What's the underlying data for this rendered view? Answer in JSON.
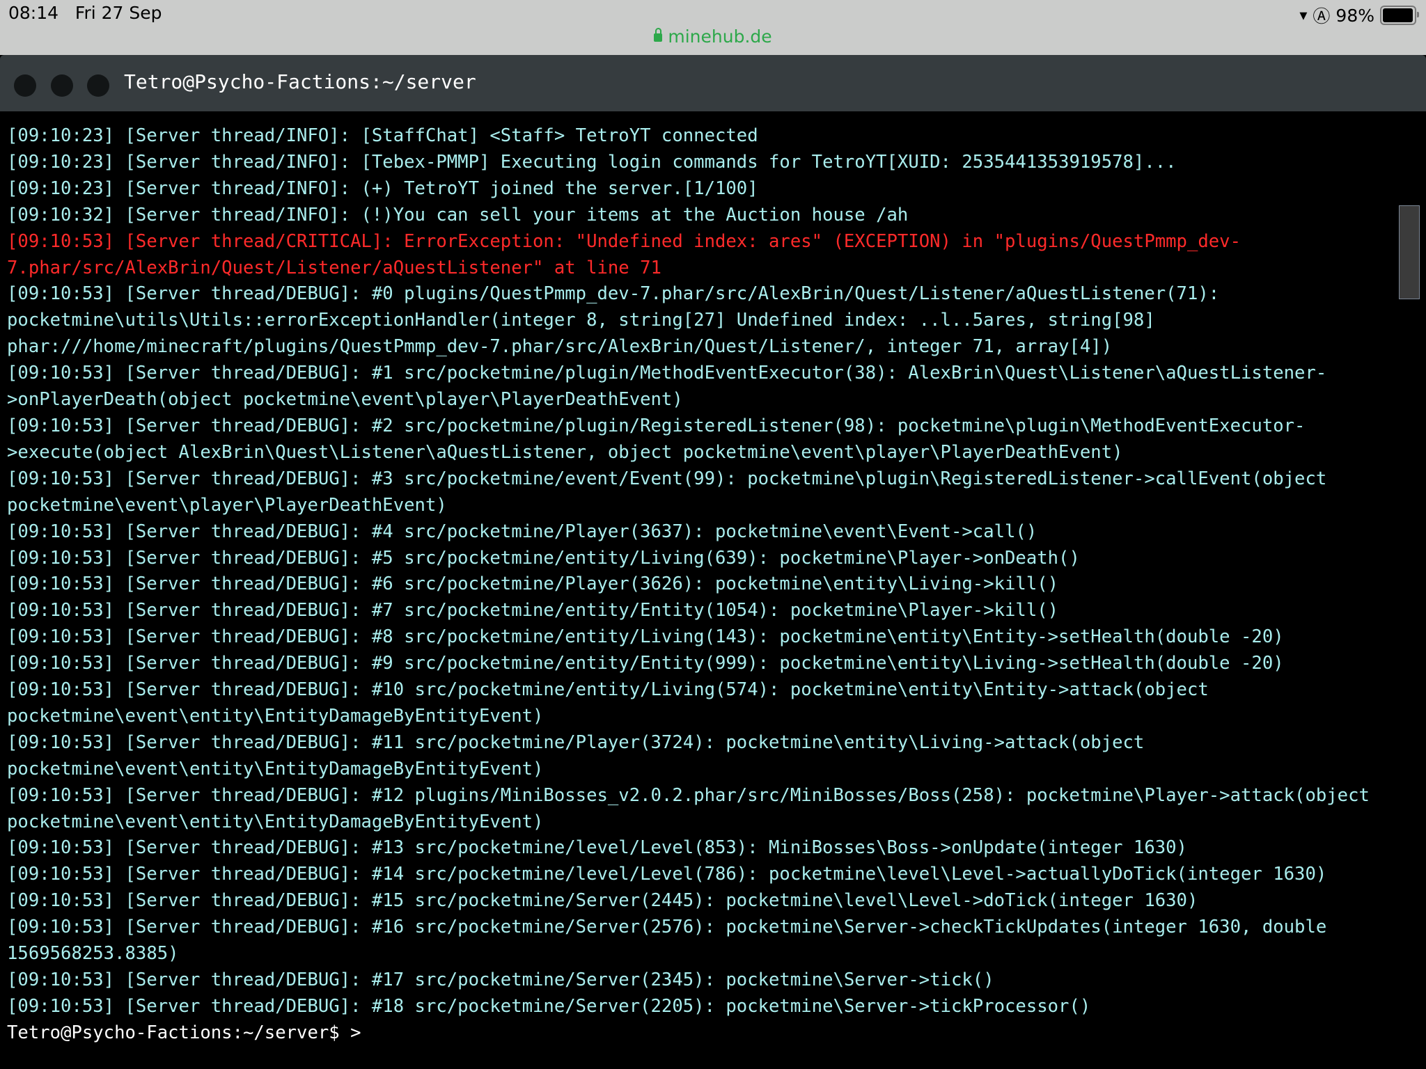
{
  "status_bar": {
    "time": "08:14",
    "date": "Fri 27 Sep",
    "battery": "98%",
    "battery_level": 0.98,
    "url": "minehub.de"
  },
  "terminal": {
    "title": "Tetro@Psycho-Factions:~/server",
    "colors": {
      "normal": "#a9eded",
      "critical": "#ff2a2a"
    },
    "lines": [
      {
        "text": "[09:10:23] [Server thread/INFO]: [StaffChat] <Staff> TetroYT connected",
        "level": "info"
      },
      {
        "text": "[09:10:23] [Server thread/INFO]: [Tebex-PMMP] Executing login commands for TetroYT[XUID: 2535441353919578]...",
        "level": "info"
      },
      {
        "text": "[09:10:23] [Server thread/INFO]: (+) TetroYT joined the server.[1/100]",
        "level": "info"
      },
      {
        "text": "[09:10:32] [Server thread/INFO]: (!)You can sell your items at the Auction house /ah",
        "level": "info"
      },
      {
        "text": "[09:10:53] [Server thread/CRITICAL]: ErrorException: \"Undefined index: ares\" (EXCEPTION) in \"plugins/QuestPmmp_dev-",
        "level": "crit"
      },
      {
        "text": "7.phar/src/AlexBrin/Quest/Listener/aQuestListener\" at line 71",
        "level": "crit"
      },
      {
        "text": "[09:10:53] [Server thread/DEBUG]: #0 plugins/QuestPmmp_dev-7.phar/src/AlexBrin/Quest/Listener/aQuestListener(71):",
        "level": "debug"
      },
      {
        "text": "pocketmine\\utils\\Utils::errorExceptionHandler(integer 8, string[27] Undefined index: ..l..5ares, string[98]",
        "level": "debug"
      },
      {
        "text": "phar:///home/minecraft/plugins/QuestPmmp_dev-7.phar/src/AlexBrin/Quest/Listener/, integer 71, array[4])",
        "level": "debug"
      },
      {
        "text": "[09:10:53] [Server thread/DEBUG]: #1 src/pocketmine/plugin/MethodEventExecutor(38): AlexBrin\\Quest\\Listener\\aQuestListener-",
        "level": "debug"
      },
      {
        "text": ">onPlayerDeath(object pocketmine\\event\\player\\PlayerDeathEvent)",
        "level": "debug"
      },
      {
        "text": "[09:10:53] [Server thread/DEBUG]: #2 src/pocketmine/plugin/RegisteredListener(98): pocketmine\\plugin\\MethodEventExecutor-",
        "level": "debug"
      },
      {
        "text": ">execute(object AlexBrin\\Quest\\Listener\\aQuestListener, object pocketmine\\event\\player\\PlayerDeathEvent)",
        "level": "debug"
      },
      {
        "text": "[09:10:53] [Server thread/DEBUG]: #3 src/pocketmine/event/Event(99): pocketmine\\plugin\\RegisteredListener->callEvent(object",
        "level": "debug"
      },
      {
        "text": "pocketmine\\event\\player\\PlayerDeathEvent)",
        "level": "debug"
      },
      {
        "text": "[09:10:53] [Server thread/DEBUG]: #4 src/pocketmine/Player(3637): pocketmine\\event\\Event->call()",
        "level": "debug"
      },
      {
        "text": "[09:10:53] [Server thread/DEBUG]: #5 src/pocketmine/entity/Living(639): pocketmine\\Player->onDeath()",
        "level": "debug"
      },
      {
        "text": "[09:10:53] [Server thread/DEBUG]: #6 src/pocketmine/Player(3626): pocketmine\\entity\\Living->kill()",
        "level": "debug"
      },
      {
        "text": "[09:10:53] [Server thread/DEBUG]: #7 src/pocketmine/entity/Entity(1054): pocketmine\\Player->kill()",
        "level": "debug"
      },
      {
        "text": "[09:10:53] [Server thread/DEBUG]: #8 src/pocketmine/entity/Living(143): pocketmine\\entity\\Entity->setHealth(double -20)",
        "level": "debug"
      },
      {
        "text": "[09:10:53] [Server thread/DEBUG]: #9 src/pocketmine/entity/Entity(999): pocketmine\\entity\\Living->setHealth(double -20)",
        "level": "debug"
      },
      {
        "text": "[09:10:53] [Server thread/DEBUG]: #10 src/pocketmine/entity/Living(574): pocketmine\\entity\\Entity->attack(object",
        "level": "debug"
      },
      {
        "text": "pocketmine\\event\\entity\\EntityDamageByEntityEvent)",
        "level": "debug"
      },
      {
        "text": "[09:10:53] [Server thread/DEBUG]: #11 src/pocketmine/Player(3724): pocketmine\\entity\\Living->attack(object",
        "level": "debug"
      },
      {
        "text": "pocketmine\\event\\entity\\EntityDamageByEntityEvent)",
        "level": "debug"
      },
      {
        "text": "[09:10:53] [Server thread/DEBUG]: #12 plugins/MiniBosses_v2.0.2.phar/src/MiniBosses/Boss(258): pocketmine\\Player->attack(object",
        "level": "debug"
      },
      {
        "text": "pocketmine\\event\\entity\\EntityDamageByEntityEvent)",
        "level": "debug"
      },
      {
        "text": "[09:10:53] [Server thread/DEBUG]: #13 src/pocketmine/level/Level(853): MiniBosses\\Boss->onUpdate(integer 1630)",
        "level": "debug"
      },
      {
        "text": "[09:10:53] [Server thread/DEBUG]: #14 src/pocketmine/level/Level(786): pocketmine\\level\\Level->actuallyDoTick(integer 1630)",
        "level": "debug"
      },
      {
        "text": "[09:10:53] [Server thread/DEBUG]: #15 src/pocketmine/Server(2445): pocketmine\\level\\Level->doTick(integer 1630)",
        "level": "debug"
      },
      {
        "text": "[09:10:53] [Server thread/DEBUG]: #16 src/pocketmine/Server(2576): pocketmine\\Server->checkTickUpdates(integer 1630, double",
        "level": "debug"
      },
      {
        "text": "1569568253.8385)",
        "level": "debug"
      },
      {
        "text": "[09:10:53] [Server thread/DEBUG]: #17 src/pocketmine/Server(2345): pocketmine\\Server->tick()",
        "level": "debug"
      },
      {
        "text": "[09:10:53] [Server thread/DEBUG]: #18 src/pocketmine/Server(2205): pocketmine\\Server->tickProcessor()",
        "level": "debug"
      }
    ],
    "prompt": "Tetro@Psycho-Factions:~/server$ >"
  }
}
